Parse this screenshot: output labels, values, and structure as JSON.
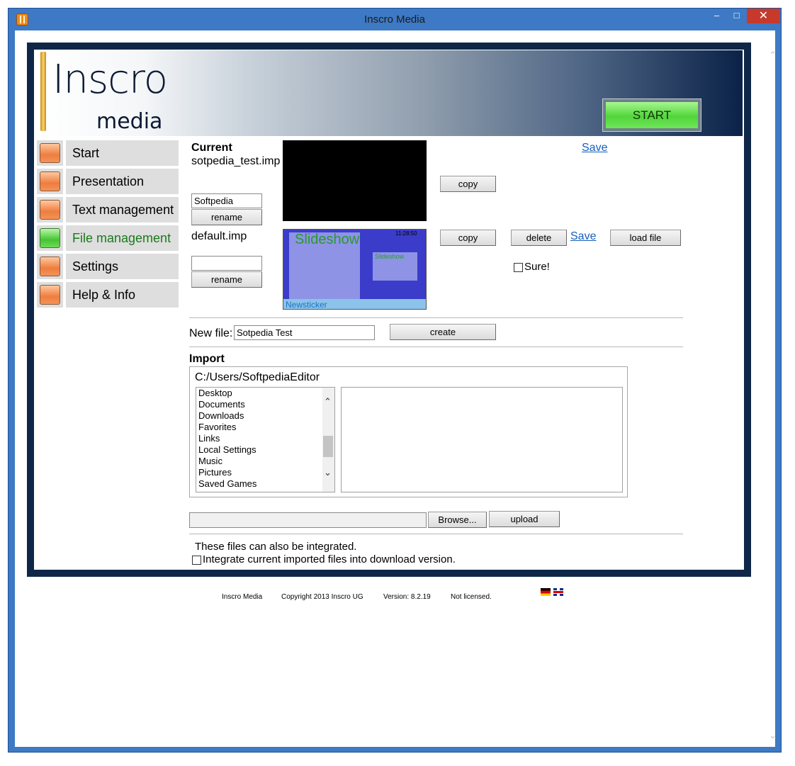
{
  "window": {
    "title": "Inscro Media",
    "minimize": "–",
    "maximize": "□",
    "close": "✕",
    "scroll_up": "^",
    "scroll_down": "v"
  },
  "banner": {
    "logo_top": "Inscro",
    "logo_bottom": "media",
    "start_label": "START"
  },
  "nav": {
    "items": [
      {
        "label": "Start",
        "state": "orange"
      },
      {
        "label": "Presentation",
        "state": "orange"
      },
      {
        "label": "Text management",
        "state": "orange"
      },
      {
        "label": "File management",
        "state": "green"
      },
      {
        "label": "Settings",
        "state": "orange"
      },
      {
        "label": "Help & Info",
        "state": "orange"
      }
    ]
  },
  "files": {
    "current_heading": "Current",
    "current_file": "sotpedia_test.imp",
    "save1": "Save",
    "copy1": "copy",
    "rename1_value": "Softpedia",
    "rename_label": "rename",
    "default_file": "default.imp",
    "copy2": "copy",
    "delete_label": "delete",
    "save2": "Save",
    "load_file": "load file",
    "sure_label": "Sure!",
    "rename2_value": "",
    "preview": {
      "title": "Slideshow",
      "small_title": "Slideshow",
      "time": "11:28:50",
      "ticker": "Newsticker"
    }
  },
  "newfile": {
    "label": "New file:",
    "value": "Sotpedia Test",
    "create_label": "create"
  },
  "import": {
    "heading": "Import",
    "path": "C:/Users/SoftpediaEditor",
    "dirs": [
      "Desktop",
      "Documents",
      "Downloads",
      "Favorites",
      "Links",
      "Local Settings",
      "Music",
      "Pictures",
      "Saved Games"
    ],
    "browse_label": "Browse...",
    "upload_label": "upload"
  },
  "integrate": {
    "line1": "These files can also be integrated.",
    "line2": "Integrate current imported files into download version."
  },
  "footer": {
    "app": "Inscro Media",
    "copyright": "Copyright 2013 Inscro UG",
    "version": "Version: 8.2.19",
    "license": "Not licensed."
  },
  "colors": {
    "frame": "#0e2748",
    "window_border": "#3d79c4",
    "link": "#1560bd",
    "active_nav": "#1a7a1a"
  }
}
